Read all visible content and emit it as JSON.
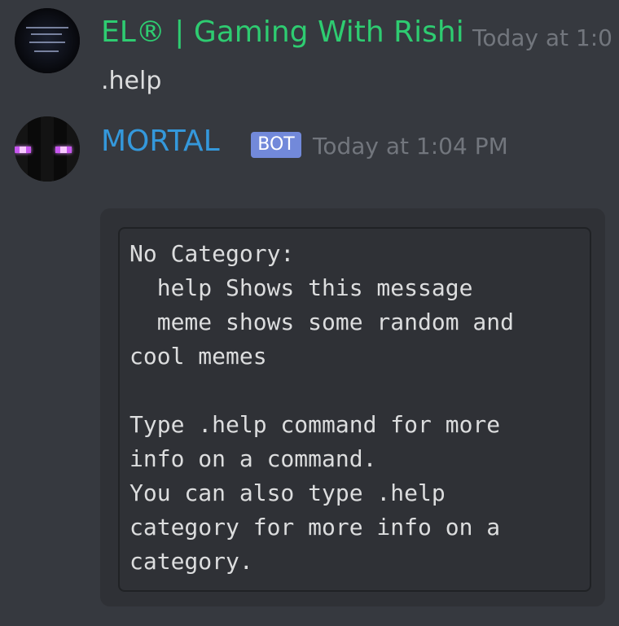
{
  "messages": [
    {
      "username": "EL® | Gaming With Rishi",
      "timestamp": "Today at 1:0",
      "content": ".help",
      "avatar_icon": "server-banner-avatar",
      "name_color": "#2ecc71"
    },
    {
      "username": "MORTAL",
      "badge": "BOT",
      "timestamp": "Today at 1:04 PM",
      "avatar_icon": "enderman-face-avatar",
      "name_color": "#3498db",
      "code_block": "No Category:\n  help Shows this message\n  meme shows some random and\ncool memes\n\nType .help command for more\ninfo on a command.\nYou can also type .help\ncategory for more info on a\ncategory."
    }
  ],
  "theme": {
    "background": "#36393f",
    "code_background": "#2f3136",
    "text": "#dcddde",
    "muted": "#72767d",
    "bot_badge": "#7289da"
  }
}
